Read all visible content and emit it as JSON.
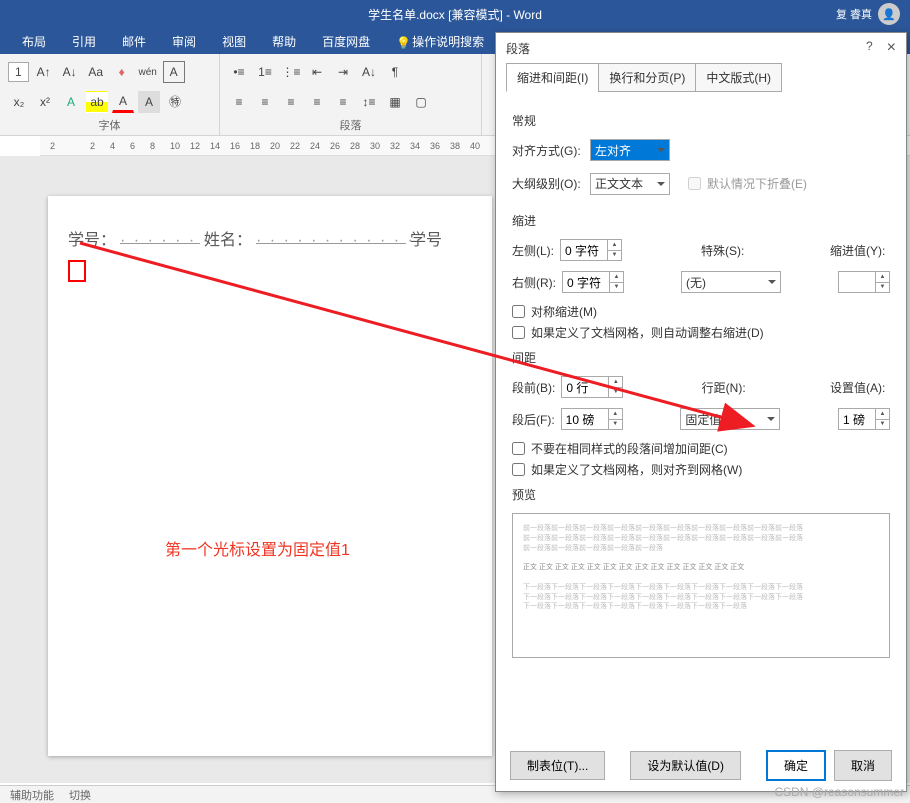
{
  "title_bar": {
    "document_title": "学生名单.docx [兼容模式] - Word",
    "user_name": "复 睿真"
  },
  "ribbon_tabs": [
    "布局",
    "引用",
    "邮件",
    "审阅",
    "视图",
    "帮助",
    "百度网盘"
  ],
  "tell_me": "操作说明搜索",
  "ribbon": {
    "font_group_label": "字体",
    "paragraph_group_label": "段落",
    "size_input": "1"
  },
  "ruler_numbers": [
    "2",
    "",
    "2",
    "4",
    "6",
    "8",
    "10",
    "12",
    "14",
    "16",
    "18",
    "20",
    "22",
    "24",
    "26",
    "28",
    "30",
    "32",
    "34",
    "36",
    "38",
    "40"
  ],
  "document": {
    "label1": "学号：",
    "label2": "姓名：",
    "label3": "学号",
    "annotation": "第一个光标设置为固定值1"
  },
  "dialog": {
    "title": "段落",
    "help_icon": "?",
    "close_icon": "×",
    "tabs": [
      "缩进和间距(I)",
      "换行和分页(P)",
      "中文版式(H)"
    ],
    "section_general": "常规",
    "alignment_label": "对齐方式(G):",
    "alignment_value": "左对齐",
    "outline_label": "大纲级别(O):",
    "outline_value": "正文文本",
    "collapse_check": "默认情况下折叠(E)",
    "section_indent": "缩进",
    "left_label": "左侧(L):",
    "left_value": "0 字符",
    "right_label": "右侧(R):",
    "right_value": "0 字符",
    "special_label": "特殊(S):",
    "special_value": "(无)",
    "indent_value_label": "缩进值(Y):",
    "indent_value": "",
    "mirror_check": "对称缩进(M)",
    "grid_indent_check": "如果定义了文档网格，则自动调整右缩进(D)",
    "section_spacing": "间距",
    "before_label": "段前(B):",
    "before_value": "0 行",
    "after_label": "段后(F):",
    "after_value": "10 磅",
    "line_spacing_label": "行距(N):",
    "line_spacing_value": "固定值",
    "set_value_label": "设置值(A):",
    "set_value": "1 磅",
    "no_space_check": "不要在相同样式的段落间增加间距(C)",
    "grid_align_check": "如果定义了文档网格，则对齐到网格(W)",
    "section_preview": "预览",
    "tabs_button": "制表位(T)...",
    "default_button": "设为默认值(D)",
    "ok_button": "确定",
    "cancel_button": "取消"
  },
  "status_bar": {
    "accessibility": "辅助功能",
    "switch": "切换"
  },
  "watermark": "CSDN @reasonsummer"
}
